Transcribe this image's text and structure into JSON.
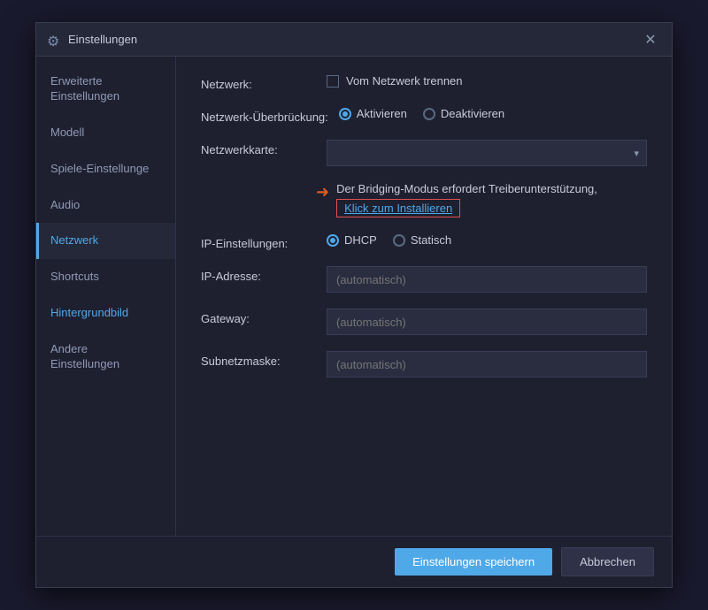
{
  "dialog": {
    "title": "Einstellungen",
    "close_label": "✕"
  },
  "sidebar": {
    "items": [
      {
        "id": "erweiterte-einstellungen",
        "label": "Erweiterte\nEinstellungen",
        "active": false,
        "blue": false
      },
      {
        "id": "modell",
        "label": "Modell",
        "active": false,
        "blue": false
      },
      {
        "id": "spiele-einstellungen",
        "label": "Spiele-Einstellunge",
        "active": false,
        "blue": false
      },
      {
        "id": "audio",
        "label": "Audio",
        "active": false,
        "blue": false
      },
      {
        "id": "netzwerk",
        "label": "Netzwerk",
        "active": true,
        "blue": false
      },
      {
        "id": "shortcuts",
        "label": "Shortcuts",
        "active": false,
        "blue": false
      },
      {
        "id": "hintergrundbild",
        "label": "Hintergrundbild",
        "active": false,
        "blue": true
      },
      {
        "id": "andere-einstellungen",
        "label": "Andere\nEinstellungen",
        "active": false,
        "blue": false
      }
    ]
  },
  "content": {
    "rows": [
      {
        "id": "netzwerk-row",
        "label": "Netzwerk:",
        "type": "checkbox",
        "checkbox_label": "Vom Netzwerk trennen"
      },
      {
        "id": "netzwerk-ueberbr-row",
        "label": "Netzwerk-Überbrückung:",
        "type": "radio",
        "options": [
          {
            "id": "aktivieren",
            "label": "Aktivieren",
            "selected": true
          },
          {
            "id": "deaktivieren",
            "label": "Deaktivieren",
            "selected": false
          }
        ]
      },
      {
        "id": "netzwerkkarte-row",
        "label": "Netzwerkkarte:",
        "type": "select",
        "value": ""
      },
      {
        "id": "warning-row",
        "type": "warning",
        "text": "Der Bridging-Modus erfordert Treiberunterstützung,",
        "link_text": "Klick zum Installieren"
      },
      {
        "id": "ip-einstellungen-row",
        "label": "IP-Einstellungen:",
        "type": "radio",
        "options": [
          {
            "id": "dhcp",
            "label": "DHCP",
            "selected": true
          },
          {
            "id": "statisch",
            "label": "Statisch",
            "selected": false
          }
        ]
      },
      {
        "id": "ip-adresse-row",
        "label": "IP-Adresse:",
        "type": "input",
        "placeholder": "(automatisch)"
      },
      {
        "id": "gateway-row",
        "label": "Gateway:",
        "type": "input",
        "placeholder": "(automatisch)"
      },
      {
        "id": "subnetzmaske-row",
        "label": "Subnetzmaske:",
        "type": "input",
        "placeholder": "(automatisch)"
      }
    ]
  },
  "footer": {
    "save_label": "Einstellungen speichern",
    "cancel_label": "Abbrechen"
  },
  "icons": {
    "gear": "⚙",
    "arrow_right": "➜",
    "chevron_down": "▾"
  }
}
